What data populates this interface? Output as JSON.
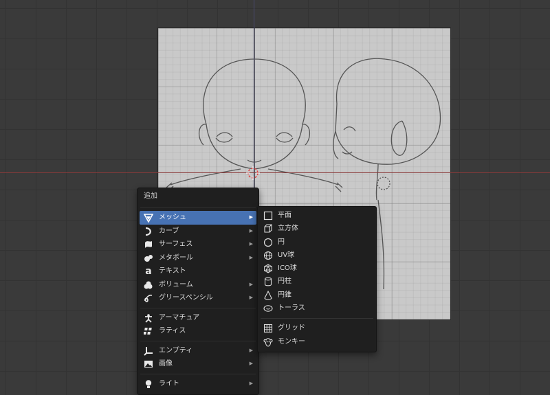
{
  "add_menu": {
    "title": "追加",
    "groups": [
      [
        {
          "label": "メッシュ",
          "icon": "mesh-icon",
          "has_submenu": true,
          "active": true
        },
        {
          "label": "カーブ",
          "icon": "curve-icon",
          "has_submenu": true
        },
        {
          "label": "サーフェス",
          "icon": "surface-icon",
          "has_submenu": true
        },
        {
          "label": "メタボール",
          "icon": "metaball-icon",
          "has_submenu": true
        },
        {
          "label": "テキスト",
          "icon": "text-icon",
          "has_submenu": false
        },
        {
          "label": "ボリューム",
          "icon": "volume-icon",
          "has_submenu": true
        },
        {
          "label": "グリースペンシル",
          "icon": "grease-pencil-icon",
          "has_submenu": true
        }
      ],
      [
        {
          "label": "アーマチュア",
          "icon": "armature-icon",
          "has_submenu": false
        },
        {
          "label": "ラティス",
          "icon": "lattice-icon",
          "has_submenu": false
        }
      ],
      [
        {
          "label": "エンプティ",
          "icon": "empty-icon",
          "has_submenu": true
        },
        {
          "label": "画像",
          "icon": "image-icon",
          "has_submenu": true
        }
      ],
      [
        {
          "label": "ライト",
          "icon": "light-icon",
          "has_submenu": true
        }
      ]
    ]
  },
  "mesh_submenu": {
    "items": [
      {
        "label": "平面",
        "icon": "plane-icon"
      },
      {
        "label": "立方体",
        "icon": "cube-icon"
      },
      {
        "label": "円",
        "icon": "circle-icon"
      },
      {
        "label": "UV球",
        "icon": "uv-sphere-icon"
      },
      {
        "label": "ICO球",
        "icon": "ico-sphere-icon"
      },
      {
        "label": "円柱",
        "icon": "cylinder-icon"
      },
      {
        "label": "円錐",
        "icon": "cone-icon"
      },
      {
        "label": "トーラス",
        "icon": "torus-icon"
      }
    ],
    "extra_items": [
      {
        "label": "グリッド",
        "icon": "grid-icon"
      },
      {
        "label": "モンキー",
        "icon": "monkey-icon"
      }
    ]
  },
  "colors": {
    "active_highlight": "#4772b3",
    "menu_background": "#1f1f1f",
    "viewport_background": "#3a3a3a",
    "x_axis": "#8a3a3a"
  }
}
